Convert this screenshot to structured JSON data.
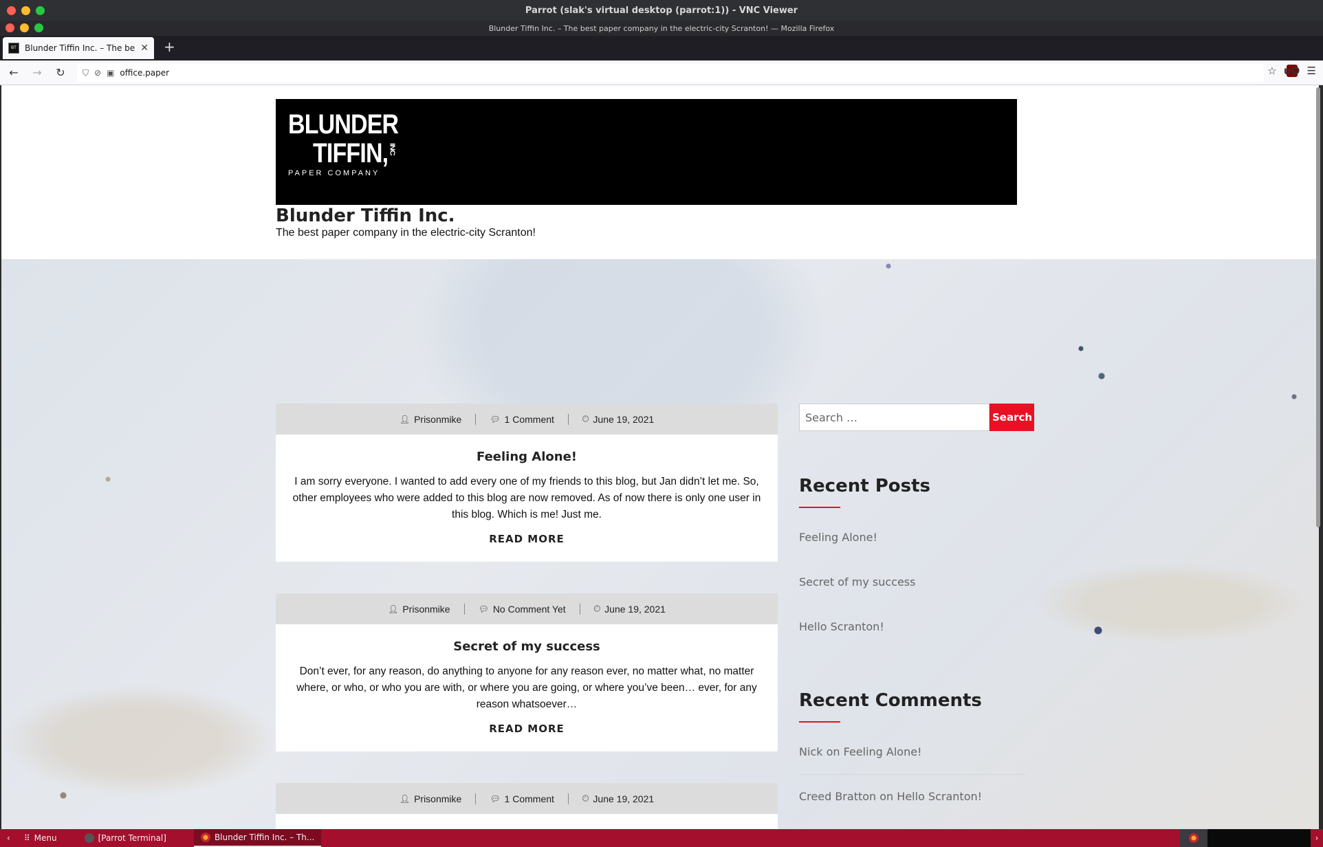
{
  "vnc": {
    "title": "Parrot (slak's virtual desktop (parrot:1)) - VNC Viewer"
  },
  "browser": {
    "window_title": "Blunder Tiffin Inc. – The best paper company in the electric-city Scranton! — Mozilla Firefox",
    "tab_title": "Blunder Tiffin Inc. – The best pap",
    "new_tab": "+",
    "url": "office.paper"
  },
  "site": {
    "logo": {
      "line1": "BLUNDER",
      "line2": "TIFFIN,",
      "inc": "INC",
      "line3": "PAPER COMPANY"
    },
    "title": "Blunder Tiffin Inc.",
    "description": "The best paper company in the electric-city Scranton!"
  },
  "posts": [
    {
      "author": "Prisonmike",
      "comments": "1 Comment",
      "date": "June 19, 2021",
      "title": "Feeling Alone!",
      "excerpt": "I am sorry everyone. I wanted to add every one of my friends to this blog, but Jan didn’t let me. So, other employees who were added to this blog are now removed. As of now there is only one user in this blog. Which is me! Just me.",
      "read_more": "READ MORE"
    },
    {
      "author": "Prisonmike",
      "comments": "No Comment Yet",
      "date": "June 19, 2021",
      "title": "Secret of my success",
      "excerpt": "Don’t ever, for any reason, do anything to anyone for any reason ever, no matter what, no matter where, or who, or who you are with, or where you are going, or where you’ve been… ever, for any reason whatsoever…",
      "read_more": "READ MORE"
    },
    {
      "author": "Prisonmike",
      "comments": "1 Comment",
      "date": "June 19, 2021"
    }
  ],
  "sidebar": {
    "search_placeholder": "Search …",
    "search_button": "Search",
    "recent_posts_title": "Recent Posts",
    "recent_posts": [
      "Feeling Alone!",
      "Secret of my success",
      "Hello Scranton!"
    ],
    "recent_comments_title": "Recent Comments",
    "recent_comments": [
      {
        "author": "Nick",
        "on": "on",
        "post": "Feeling Alone!"
      },
      {
        "author": "Creed Bratton",
        "on": "on",
        "post": "Hello Scranton!"
      }
    ]
  },
  "taskbar": {
    "menu": "Menu",
    "terminal": "[Parrot Terminal]",
    "firefox": "Blunder Tiffin Inc. – Th..."
  }
}
